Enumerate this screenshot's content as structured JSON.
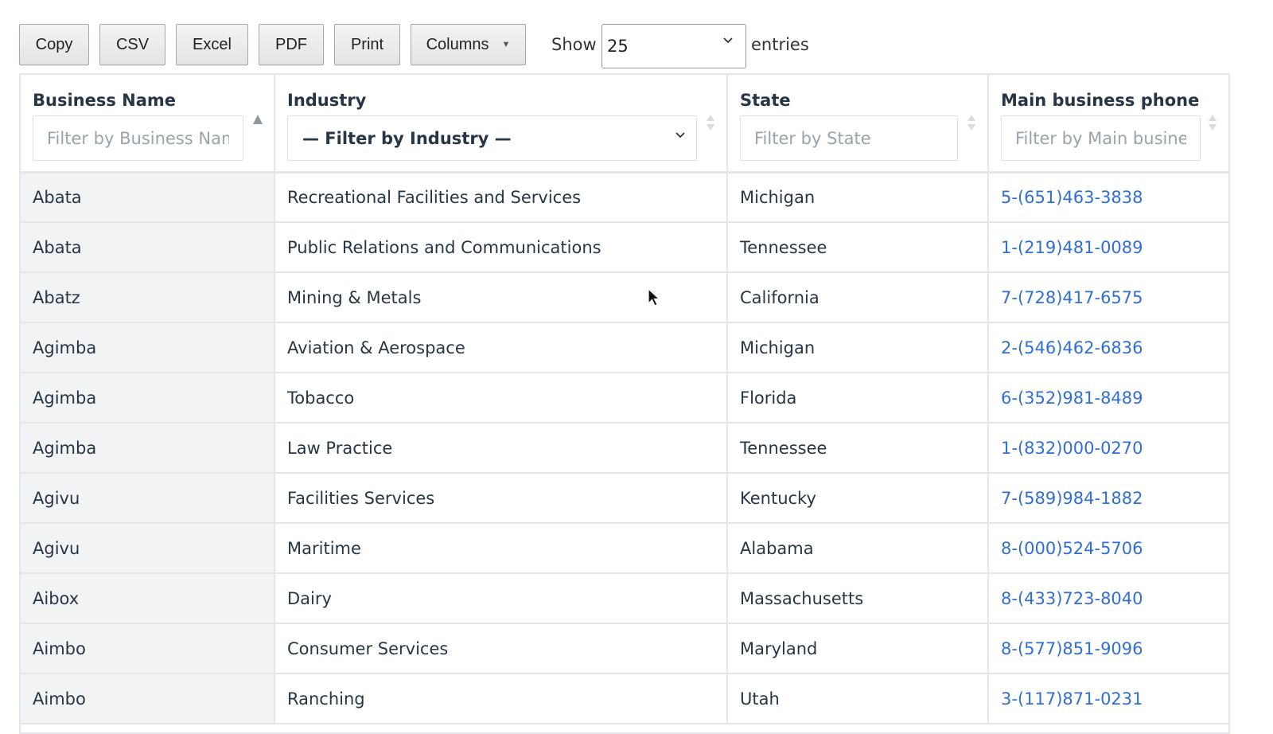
{
  "toolbar": {
    "buttons": [
      "Copy",
      "CSV",
      "Excel",
      "PDF",
      "Print",
      "Columns"
    ],
    "show_label": "Show",
    "page_length": "25",
    "entries_label": "entries"
  },
  "table": {
    "columns": [
      {
        "title": "Business Name",
        "filter_placeholder": "Filter by Business Name",
        "sort": "ascending"
      },
      {
        "title": "Industry",
        "filter_value": "— Filter by Industry —",
        "sort": "none"
      },
      {
        "title": "State",
        "filter_placeholder": "Filter by State",
        "sort": "none"
      },
      {
        "title": "Main business phone",
        "filter_placeholder": "Filter by Main business phone",
        "sort": "none"
      }
    ],
    "rows": [
      [
        "Abata",
        "Recreational Facilities and Services",
        "Michigan",
        "5-(651)463-3838"
      ],
      [
        "Abata",
        "Public Relations and Communications",
        "Tennessee",
        "1-(219)481-0089"
      ],
      [
        "Abatz",
        "Mining & Metals",
        "California",
        "7-(728)417-6575"
      ],
      [
        "Agimba",
        "Aviation & Aerospace",
        "Michigan",
        "2-(546)462-6836"
      ],
      [
        "Agimba",
        "Tobacco",
        "Florida",
        "6-(352)981-8489"
      ],
      [
        "Agimba",
        "Law Practice",
        "Tennessee",
        "1-(832)000-0270"
      ],
      [
        "Agivu",
        "Facilities Services",
        "Kentucky",
        "7-(589)984-1882"
      ],
      [
        "Agivu",
        "Maritime",
        "Alabama",
        "8-(000)524-5706"
      ],
      [
        "Aibox",
        "Dairy",
        "Massachusetts",
        "8-(433)723-8040"
      ],
      [
        "Aimbo",
        "Consumer Services",
        "Maryland",
        "8-(577)851-9096"
      ],
      [
        "Aimbo",
        "Ranching",
        "Utah",
        "3-(117)871-0231"
      ]
    ]
  },
  "colors": {
    "link": "#2f6fd6",
    "border": "#e3e7ec",
    "header_text": "#273646",
    "sorted_column_bg": "#f2f3f5"
  }
}
